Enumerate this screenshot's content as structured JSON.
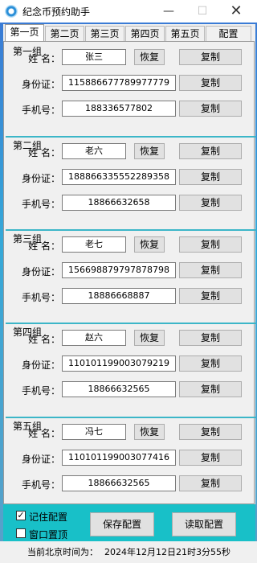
{
  "window": {
    "title": "纪念币预约助手",
    "minimize": "—",
    "maximize": "☐",
    "close": "✕"
  },
  "tabs": [
    "第一页",
    "第二页",
    "第三页",
    "第四页",
    "第五页",
    "配置"
  ],
  "labels": {
    "name": "姓  名：",
    "id": "身份证：",
    "phone": "手机号："
  },
  "buttons": {
    "restore": "恢复",
    "copy": "复制"
  },
  "groups": [
    {
      "title": "第一组",
      "name": "张三",
      "id": "115886677789977779",
      "phone": "188336577802"
    },
    {
      "title": "第二组",
      "name": "老六",
      "id": "188866335552289358",
      "phone": "18866632658"
    },
    {
      "title": "第三组",
      "name": "老七",
      "id": "156698879797878798",
      "phone": "18886668887"
    },
    {
      "title": "第四组",
      "name": "赵六",
      "id": "110101199003079219",
      "phone": "18866632565"
    },
    {
      "title": "第五组",
      "name": "冯七",
      "id": "110101199003077416",
      "phone": "18866632565"
    }
  ],
  "options": {
    "remember": "记住配置",
    "topmost": "窗口置顶",
    "remember_checked": true,
    "topmost_checked": false
  },
  "actions": {
    "save": "保存配置",
    "load": "读取配置"
  },
  "status": {
    "label": "当前北京时间为：",
    "time": "2024年12月12日21时3分55秒"
  }
}
